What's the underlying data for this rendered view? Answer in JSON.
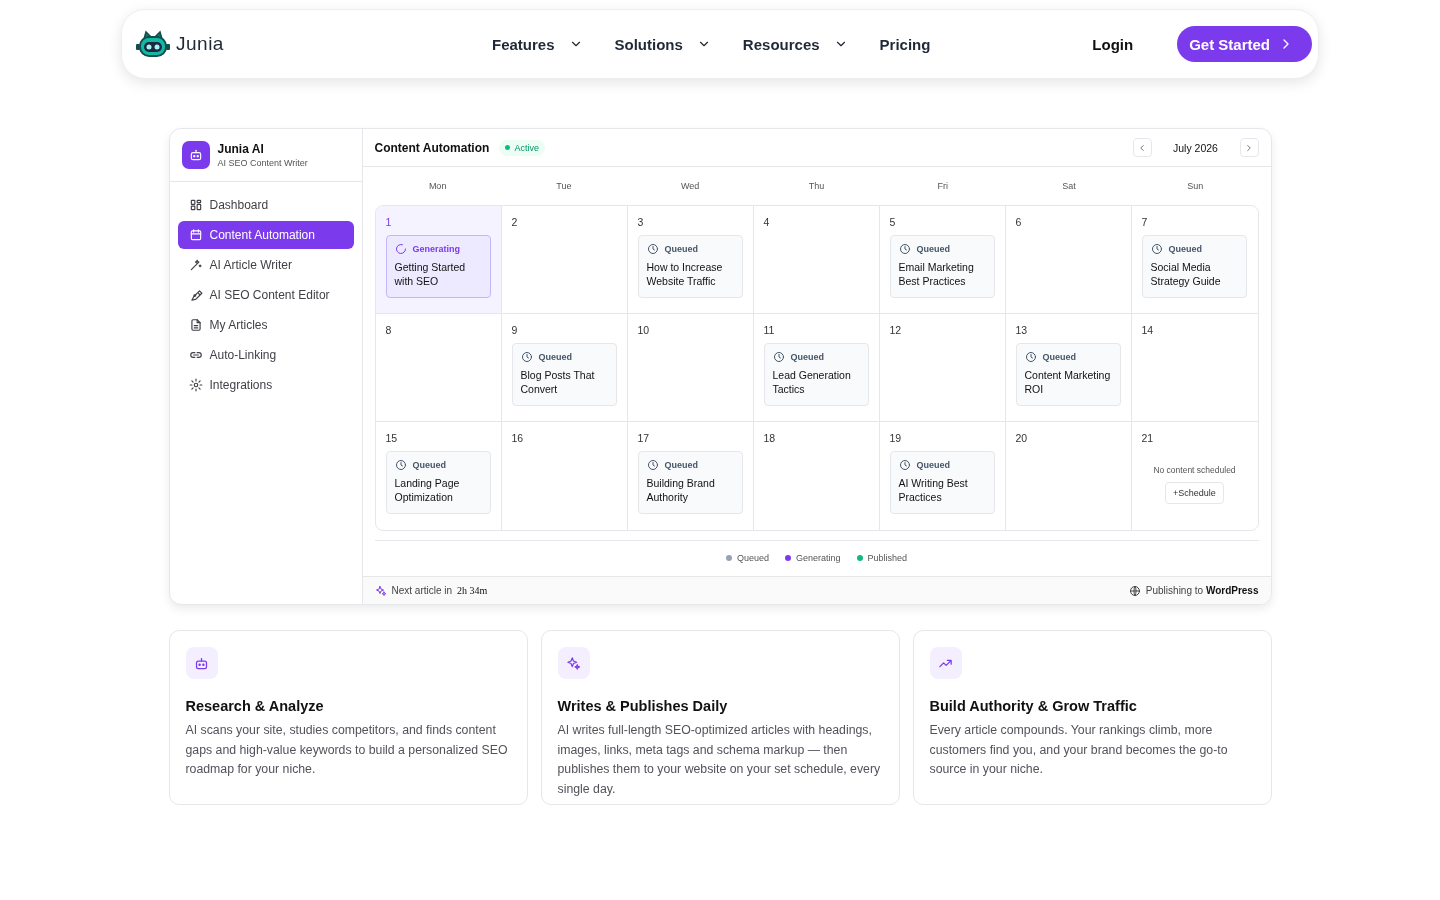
{
  "nav": {
    "brand": "Junia",
    "links": [
      {
        "label": "Features",
        "dropdown": true
      },
      {
        "label": "Solutions",
        "dropdown": true
      },
      {
        "label": "Resources",
        "dropdown": true
      },
      {
        "label": "Pricing",
        "dropdown": false
      }
    ],
    "login": "Login",
    "cta": "Get Started"
  },
  "app": {
    "sidebar": {
      "title": "Junia AI",
      "subtitle": "AI SEO Content Writer",
      "items": [
        {
          "label": "Dashboard",
          "selected": false
        },
        {
          "label": "Content Automation",
          "selected": true
        },
        {
          "label": "AI Article Writer",
          "selected": false
        },
        {
          "label": "AI SEO Content Editor",
          "selected": false
        },
        {
          "label": "My Articles",
          "selected": false
        },
        {
          "label": "Auto-Linking",
          "selected": false
        },
        {
          "label": "Integrations",
          "selected": false
        }
      ]
    },
    "header": {
      "title": "Content Automation",
      "badge": "Active",
      "month": "July 2026"
    },
    "calendar": {
      "weekdays": [
        "Mon",
        "Tue",
        "Wed",
        "Thu",
        "Fri",
        "Sat",
        "Sun"
      ],
      "weeks": [
        [
          {
            "day": "1",
            "selected": true,
            "entry": {
              "kind": "generating",
              "status": "Generating",
              "title": "Getting Started with SEO"
            }
          },
          {
            "day": "2",
            "selected": false
          },
          {
            "day": "3",
            "selected": false,
            "entry": {
              "kind": "queued",
              "status": "Queued",
              "title": "How to Increase Website Traffic"
            }
          },
          {
            "day": "4",
            "selected": false
          },
          {
            "day": "5",
            "selected": false,
            "entry": {
              "kind": "queued",
              "status": "Queued",
              "title": "Email Marketing Best Practices"
            }
          },
          {
            "day": "6",
            "selected": false
          },
          {
            "day": "7",
            "selected": false,
            "entry": {
              "kind": "queued",
              "status": "Queued",
              "title": "Social Media Strategy Guide"
            }
          }
        ],
        [
          {
            "day": "8",
            "selected": false
          },
          {
            "day": "9",
            "selected": false,
            "entry": {
              "kind": "queued",
              "status": "Queued",
              "title": "Blog Posts That Convert"
            }
          },
          {
            "day": "10",
            "selected": false
          },
          {
            "day": "11",
            "selected": false,
            "entry": {
              "kind": "queued",
              "status": "Queued",
              "title": "Lead Generation Tactics"
            }
          },
          {
            "day": "12",
            "selected": false
          },
          {
            "day": "13",
            "selected": false,
            "entry": {
              "kind": "queued",
              "status": "Queued",
              "title": "Content Marketing ROI"
            }
          },
          {
            "day": "14",
            "selected": false
          }
        ],
        [
          {
            "day": "15",
            "selected": false,
            "entry": {
              "kind": "queued",
              "status": "Queued",
              "title": "Landing Page Optimization"
            }
          },
          {
            "day": "16",
            "selected": false
          },
          {
            "day": "17",
            "selected": false,
            "entry": {
              "kind": "queued",
              "status": "Queued",
              "title": "Building Brand Authority"
            }
          },
          {
            "day": "18",
            "selected": false
          },
          {
            "day": "19",
            "selected": false,
            "entry": {
              "kind": "queued",
              "status": "Queued",
              "title": "AI Writing Best Practices"
            }
          },
          {
            "day": "20",
            "selected": false
          },
          {
            "day": "21",
            "selected": false,
            "note": "No content scheduled",
            "button": "+Schedule"
          }
        ]
      ]
    },
    "legend": [
      {
        "label": "Queued",
        "color": "#94a3b8"
      },
      {
        "label": "Generating",
        "color": "#7c3aed"
      },
      {
        "label": "Published",
        "color": "#10b981"
      }
    ],
    "footer": {
      "next_label": "Next article in",
      "next_time": "2h 34m",
      "publishing": "Publishing to **WordPress**"
    }
  },
  "features": [
    {
      "title": "Research & Analyze",
      "text": "AI scans your site, studies competitors, and finds content gaps and high-value keywords to build a personalized SEO roadmap for your niche."
    },
    {
      "title": "Writes & Publishes Daily",
      "text": "AI writes full-length SEO-optimized articles with headings, images, links, meta tags and schema markup — then publishes them to your website on your set schedule, every single day."
    },
    {
      "title": "Build Authority & Grow Traffic",
      "text": "Every article compounds. Your rankings climb, more customers find you, and your brand becomes the go-to source in your niche."
    }
  ]
}
